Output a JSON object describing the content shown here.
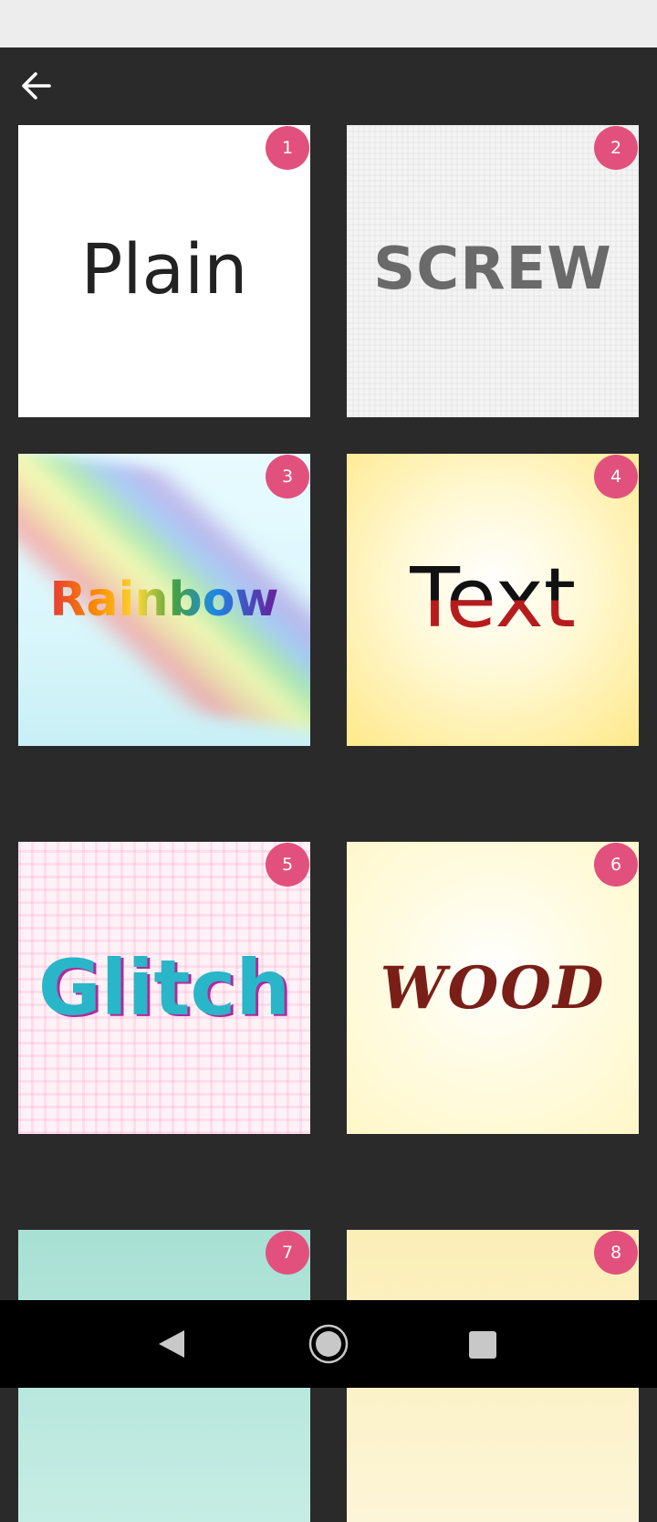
{
  "app": {
    "back_icon": "arrow-left-icon"
  },
  "styles": [
    {
      "number": "1",
      "label": "Plain"
    },
    {
      "number": "2",
      "label": "SCREW"
    },
    {
      "number": "3",
      "label": "Rainbow"
    },
    {
      "number": "4",
      "label": "Text"
    },
    {
      "number": "5",
      "label": "Glitch"
    },
    {
      "number": "6",
      "label": "WOOD"
    },
    {
      "number": "7",
      "label": ""
    },
    {
      "number": "8",
      "label": ""
    }
  ],
  "colors": {
    "badge": "#e2517e",
    "background": "#2a2a2a"
  },
  "nav": {
    "back_icon": "triangle-back-icon",
    "home_icon": "circle-home-icon",
    "recent_icon": "square-recents-icon"
  }
}
